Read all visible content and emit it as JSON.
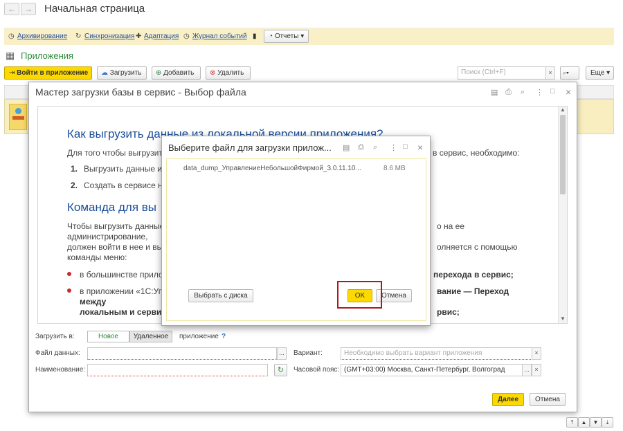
{
  "nav": {
    "back": "←",
    "forward": "→",
    "page_title": "Начальная страница"
  },
  "cmdbar": {
    "items": [
      {
        "label": "Архивирование",
        "icon": "clock-icon",
        "glyph": "◷"
      },
      {
        "label": "Синхронизация",
        "icon": "sync-icon",
        "glyph": "↻"
      },
      {
        "label": "Адаптация",
        "icon": "puzzle-icon",
        "glyph": "✚"
      },
      {
        "label": "Журнал событий",
        "icon": "history-icon",
        "glyph": "◷"
      }
    ],
    "reports_label": "Отчеты",
    "reports_arrow": "▾",
    "chart_glyph": "▮"
  },
  "section": {
    "title": "Приложения",
    "glyph": "▦"
  },
  "toolbar": {
    "enter_label": "Войти в приложение",
    "upload_label": "Загрузить",
    "add_label": "Добавить",
    "delete_label": "Удалить",
    "search_placeholder": "Поиск (Ctrl+F)",
    "clear_glyph": "×",
    "search_glyph": "🔍",
    "more_label": "Еще",
    "more_arrow": "▾"
  },
  "wizard": {
    "title": "Мастер загрузки базы в сервис - Выбор файла",
    "heading1": "Как выгрузить данные из локальной версии приложения?",
    "para1_left": "Для того чтобы выгрузит",
    "para1_right": "в сервис, необходимо:",
    "step1_num": "1.",
    "step1": "Выгрузить данные и",
    "step2_num": "2.",
    "step2": "Создать в сервисе н",
    "heading2": "Команда для вы",
    "para2_l1": "Чтобы выгрузить данные",
    "para2_r1": "о на ее",
    "para2_l2": "администрирование,",
    "para2_l3": "должен войти в нее и вы",
    "para2_r3": "олняется с помощью",
    "para2_l4": "команды меню:",
    "bullet1_left": "в большинстве прило",
    "bullet1_right": "перехода в сервис;",
    "bullet2_left": "в приложении «1С:Уп",
    "bullet2_right": "вание — Переход",
    "bullet2_l2": "между",
    "bullet2_l3": "локальным и серви",
    "bullet2_r3": "рвис;",
    "upload_to_label": "Загрузить в:",
    "toggle_new": "Новое",
    "toggle_remote": "Удаленное",
    "app_label": "приложение",
    "help_glyph": "?",
    "data_file_label": "Файл данных:",
    "variant_label": "Вариант:",
    "variant_placeholder": "Необходимо выбрать вариант приложения",
    "name_label": "Наименование:",
    "tz_label": "Часовой пояс:",
    "tz_value": "(GMT+03:00) Москва, Санкт-Петербург, Волгоград",
    "ellipsis": "...",
    "refresh_glyph": "↻",
    "next_label": "Далее",
    "cancel_label": "Отмена"
  },
  "dialog": {
    "title": "Выберите файл для загрузки прилож...",
    "file_name": "data_dump_УправлениеНебольшойФирмой_3.0.11.10...",
    "file_size": "8.6 MB",
    "choose_disk_label": "Выбрать с диска",
    "ok_label": "OK",
    "cancel_label": "Отмена"
  },
  "window_icons": {
    "save": "▤",
    "print": "⎙",
    "preview": "⌕",
    "menu": "⋮",
    "maximize": "□",
    "close": "×"
  },
  "colors": {
    "accent_yellow": "#fcd900",
    "link_blue": "#26509c",
    "heading_blue": "#1a4e9a",
    "green": "#2e8b3a",
    "highlight_red": "#b8141a"
  }
}
